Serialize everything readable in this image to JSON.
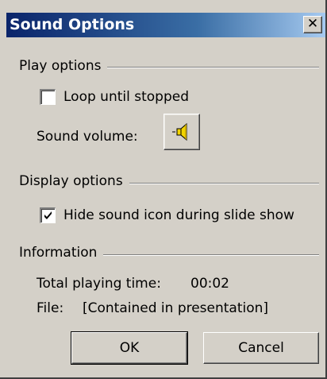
{
  "window": {
    "title": "Sound Options",
    "close_glyph": "✕"
  },
  "play_options": {
    "group_label": "Play options",
    "loop_label": "Loop until stopped",
    "loop_checked": false,
    "volume_label": "Sound volume:",
    "volume_icon": "speaker-icon"
  },
  "display_options": {
    "group_label": "Display options",
    "hide_icon_label": "Hide sound icon during slide show",
    "hide_icon_checked": true
  },
  "information": {
    "group_label": "Information",
    "playing_time_label": "Total playing time:",
    "playing_time_value": "00:02",
    "file_label": "File:",
    "file_value": "[Contained in presentation]"
  },
  "buttons": {
    "ok": "OK",
    "cancel": "Cancel"
  },
  "colors": {
    "face": "#d4d0c8",
    "title_start": "#0a246a",
    "title_end": "#a6caf0"
  }
}
